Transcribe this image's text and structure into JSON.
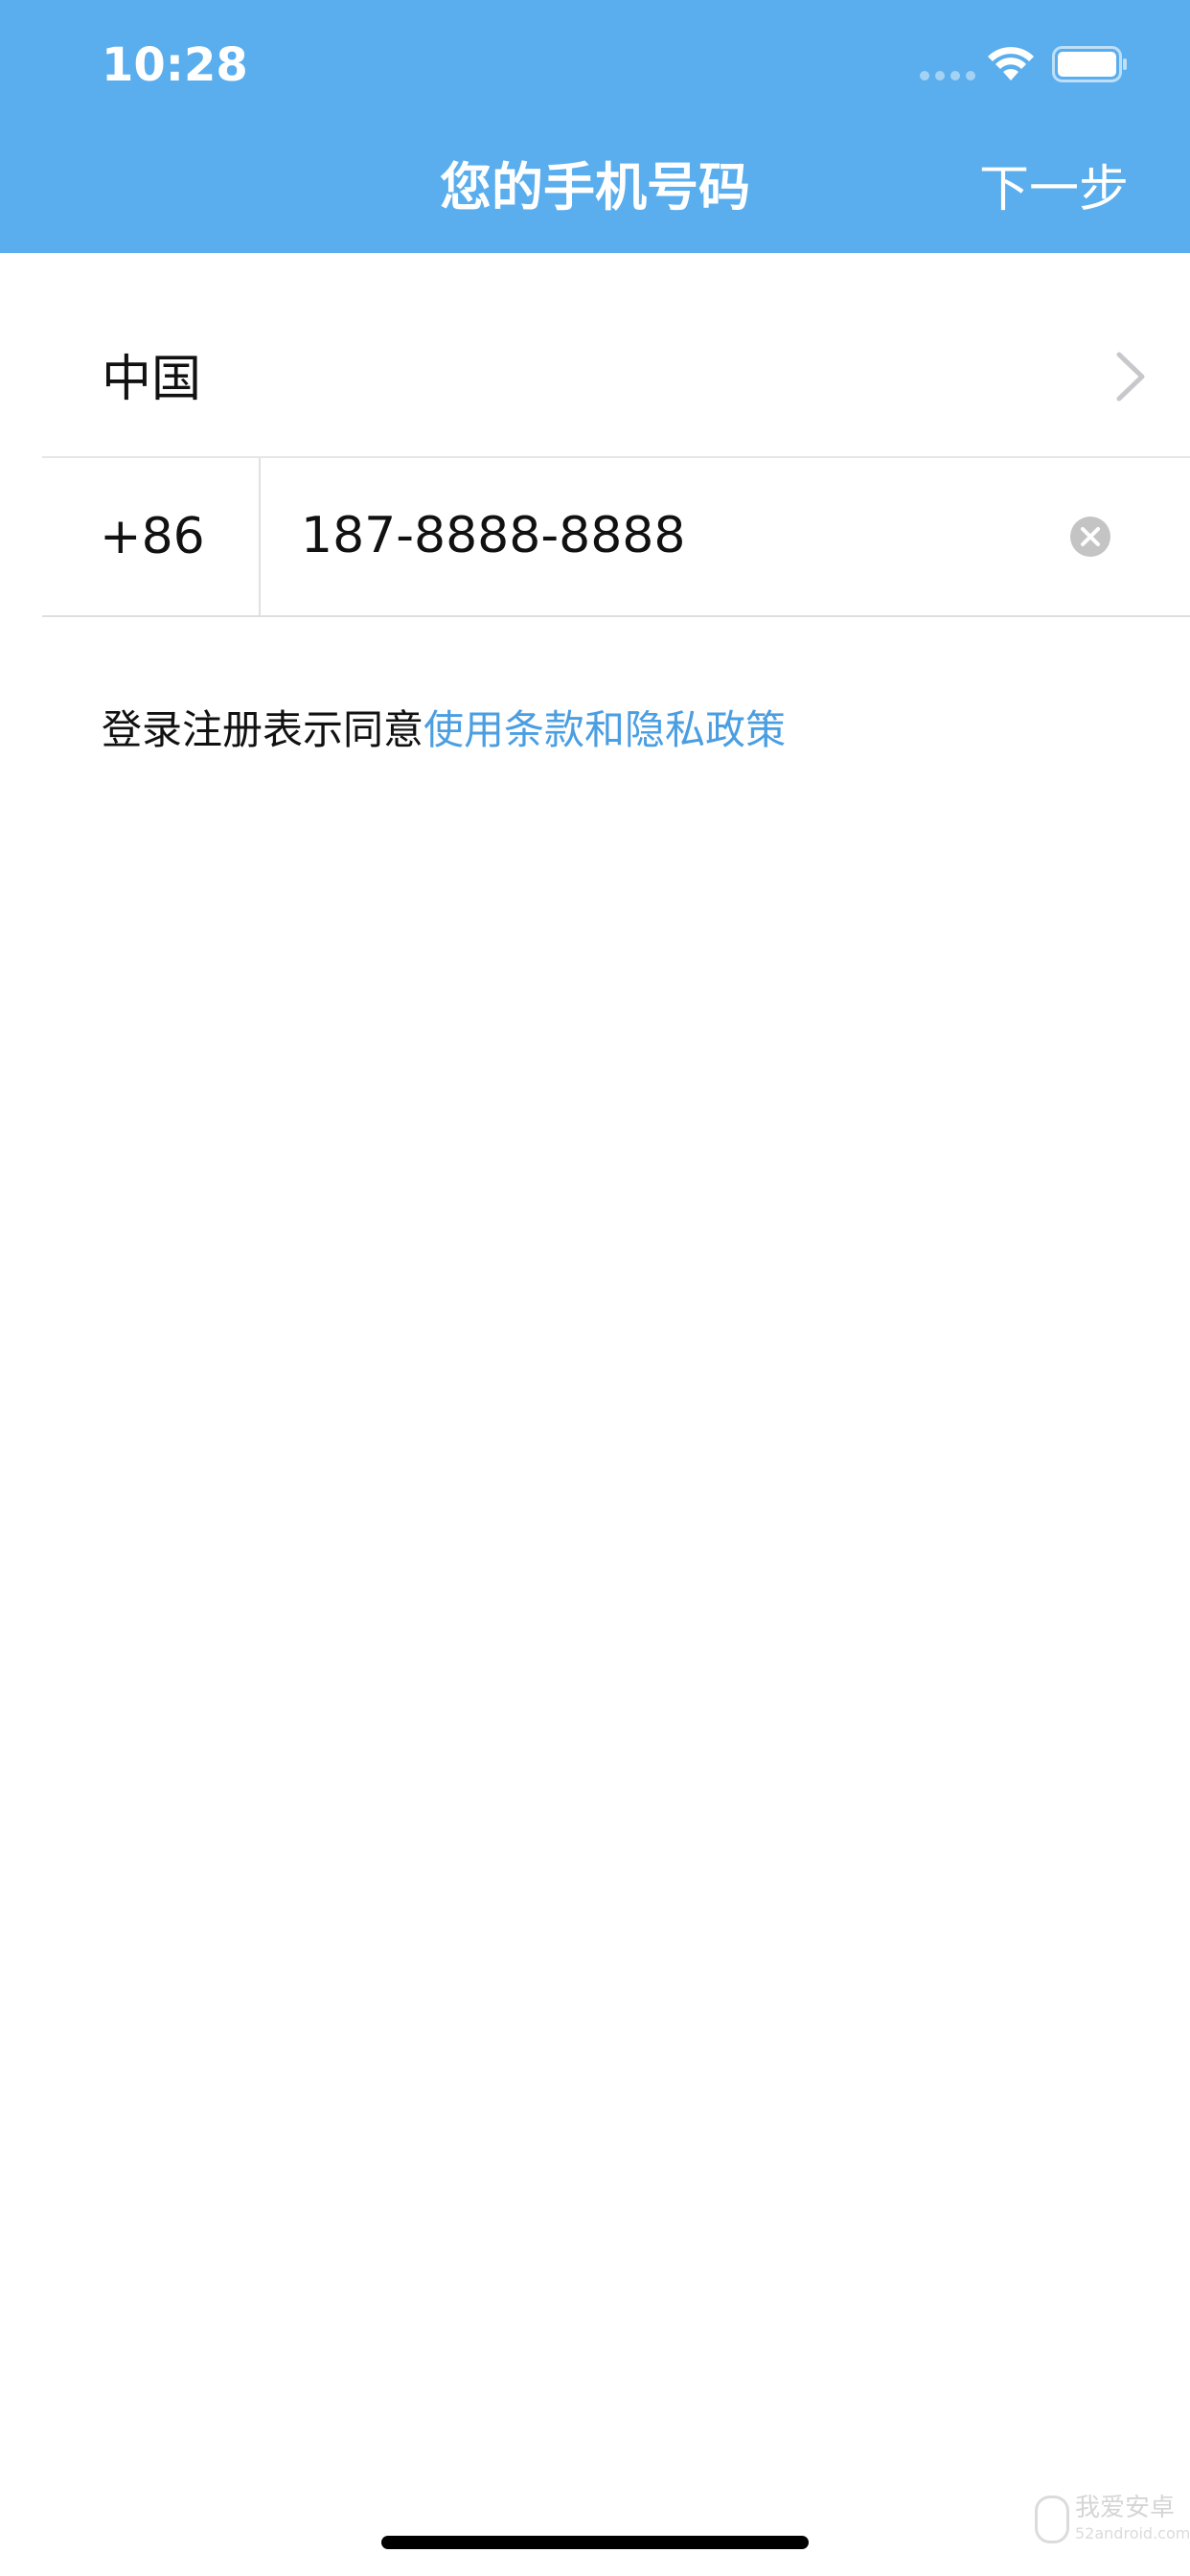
{
  "status_bar": {
    "time": "10:28"
  },
  "header": {
    "title": "您的手机号码",
    "next_label": "下一步",
    "background_color": "#5aaeed"
  },
  "form": {
    "country_name": "中国",
    "country_code": "+86",
    "phone_value": "187-8888-8888"
  },
  "terms": {
    "prefix": "登录注册表示同意",
    "link_label": "使用条款和隐私政策",
    "link_color": "#4a9ee2"
  },
  "watermark": {
    "title": "我爱安卓",
    "subtitle": "52android.com"
  },
  "icons": {
    "wifi": "wifi-icon",
    "battery": "battery-icon",
    "chevron": "chevron-right-icon",
    "clear": "clear-icon"
  }
}
